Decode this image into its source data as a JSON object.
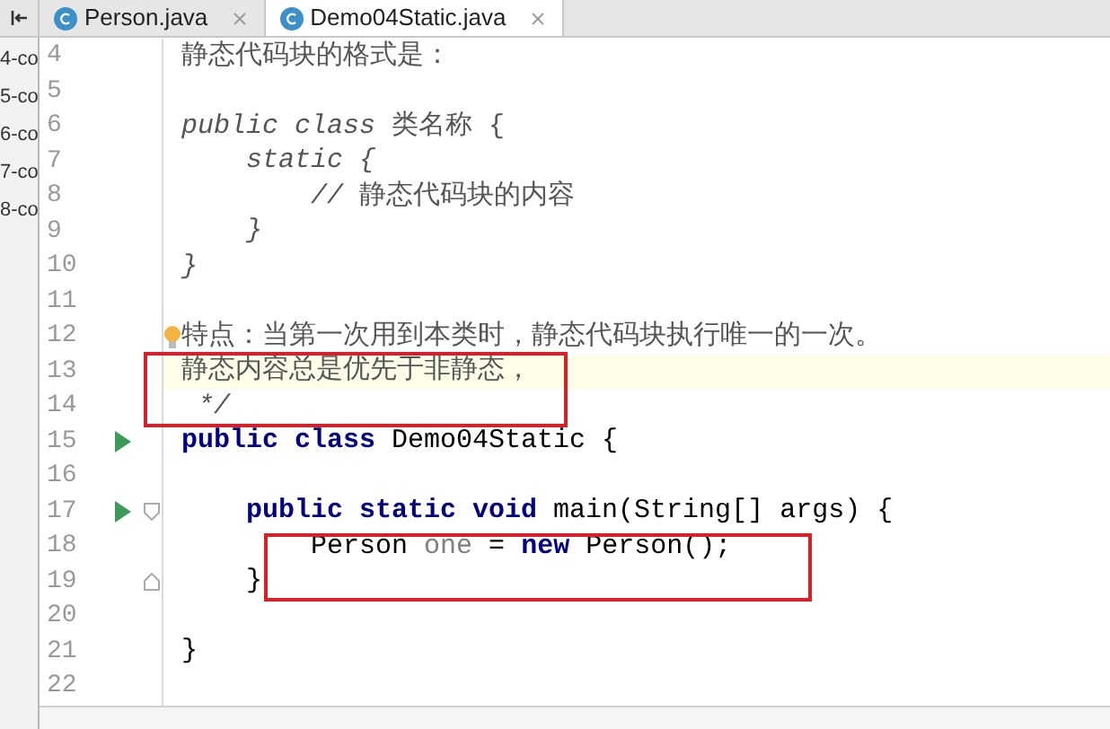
{
  "tabs": [
    {
      "label": "Person.java",
      "selected": false
    },
    {
      "label": "Demo04Static.java",
      "selected": true
    }
  ],
  "side_panel": {
    "items": [
      "4-co",
      "5-co",
      "6-co",
      "7-co",
      "8-co"
    ]
  },
  "editor": {
    "lines": [
      {
        "number": "4",
        "current": false,
        "tokens": [
          {
            "text": "静态代码块的格式是：",
            "kind": "doc"
          }
        ]
      },
      {
        "number": "5",
        "current": false
      },
      {
        "number": "6",
        "current": false,
        "tokens": [
          {
            "text": "public class ",
            "kind": "doc-italic"
          },
          {
            "text": "类名称 {",
            "kind": "doc"
          }
        ]
      },
      {
        "number": "7",
        "current": false,
        "tokens": [
          {
            "text": "    static {",
            "kind": "doc-italic"
          }
        ]
      },
      {
        "number": "8",
        "current": false,
        "tokens": [
          {
            "text": "        // ",
            "kind": "doc-italic"
          },
          {
            "text": "静态代码块的内容",
            "kind": "doc"
          }
        ]
      },
      {
        "number": "9",
        "current": false,
        "tokens": [
          {
            "text": "    }",
            "kind": "doc-italic"
          }
        ]
      },
      {
        "number": "10",
        "current": false,
        "tokens": [
          {
            "text": "}",
            "kind": "doc-italic"
          }
        ]
      },
      {
        "number": "11",
        "current": false
      },
      {
        "number": "12",
        "current": false,
        "bulb": true,
        "tokens": [
          {
            "text": "特点：当第一次用到本类时，静态代码块执行唯一的一次。",
            "kind": "doc"
          }
        ]
      },
      {
        "number": "13",
        "current": true,
        "tokens": [
          {
            "text": "静态内容总是优先于非静态，",
            "kind": "doc"
          }
        ]
      },
      {
        "number": "14",
        "current": false,
        "tokens": [
          {
            "text": " */",
            "kind": "doc-italic"
          }
        ]
      },
      {
        "number": "15",
        "current": false,
        "run_marker": true,
        "tokens": [
          {
            "text": "public class ",
            "kind": "keyword"
          },
          {
            "text": "Demo04Static {",
            "kind": "plain"
          }
        ]
      },
      {
        "number": "16",
        "current": false
      },
      {
        "number": "17",
        "current": false,
        "run_marker": true,
        "fold_start": true,
        "tokens": [
          {
            "text": "    public static void ",
            "kind": "keyword"
          },
          {
            "text": "main(String[] args) {",
            "kind": "plain"
          }
        ]
      },
      {
        "number": "18",
        "current": false,
        "tokens": [
          {
            "text": "        Person ",
            "kind": "plain"
          },
          {
            "text": "one",
            "kind": "unused"
          },
          {
            "text": " = ",
            "kind": "plain"
          },
          {
            "text": "new ",
            "kind": "keyword"
          },
          {
            "text": "Person();",
            "kind": "plain"
          }
        ]
      },
      {
        "number": "19",
        "current": false,
        "fold_end": true,
        "tokens": [
          {
            "text": "    }",
            "kind": "plain"
          }
        ]
      },
      {
        "number": "20",
        "current": false
      },
      {
        "number": "21",
        "current": false,
        "tokens": [
          {
            "text": "}",
            "kind": "plain"
          }
        ]
      },
      {
        "number": "22",
        "current": false
      }
    ]
  },
  "annotations": [
    {
      "kind": "red-box"
    },
    {
      "kind": "red-box"
    }
  ]
}
